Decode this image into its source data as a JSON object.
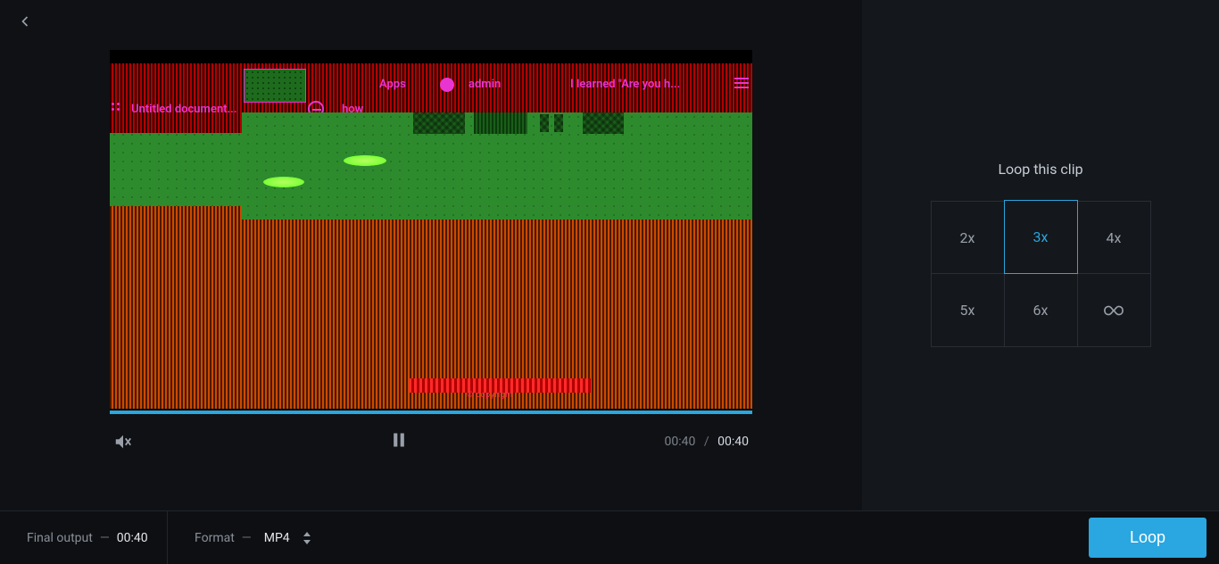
{
  "back_aria": "Back",
  "preview": {
    "bookmarks": {
      "apps": "Apps",
      "admin": "admin",
      "learned": "I learned \"Are you h...",
      "untitled": "Untitled document...",
      "how": "how"
    },
    "watermark": "© copyright"
  },
  "player": {
    "mute_aria": "Muted",
    "pause_aria": "Pause",
    "current_time": "00:40",
    "separator": "/",
    "total_time": "00:40"
  },
  "right": {
    "title": "Loop this clip",
    "options": [
      "2x",
      "3x",
      "4x",
      "5x",
      "6x"
    ],
    "infinity_aria": "Infinite",
    "selected_index": 1
  },
  "bottom": {
    "final_output_label": "Final output",
    "final_output_dash": "—",
    "final_output_value": "00:40",
    "format_label": "Format",
    "format_dash": "—",
    "format_value": "MP4",
    "loop_button": "Loop"
  }
}
